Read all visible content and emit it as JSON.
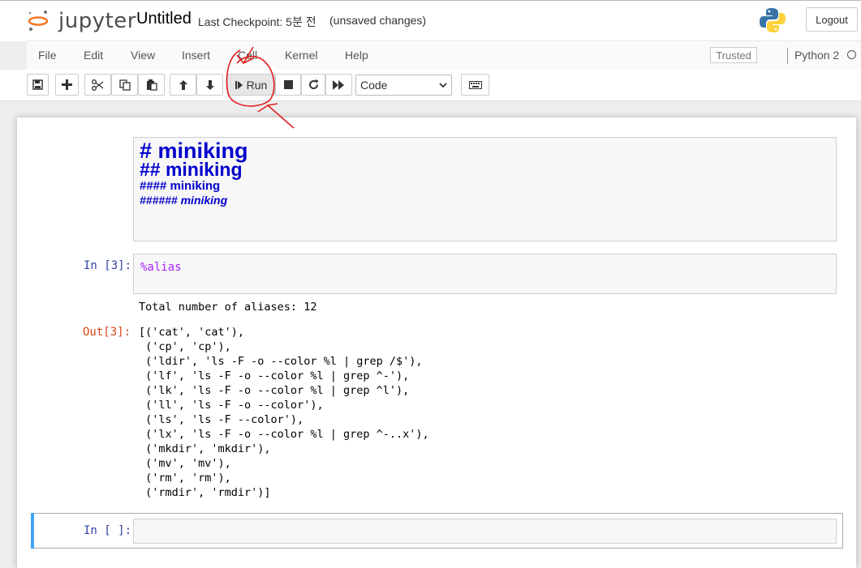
{
  "header": {
    "logo_text": "jupyter",
    "notebook_title": "Untitled",
    "checkpoint": "Last Checkpoint: 5분 전",
    "unsaved": "(unsaved changes)",
    "logout_label": "Logout"
  },
  "menubar": {
    "items": [
      "File",
      "Edit",
      "View",
      "Insert",
      "Cell",
      "Kernel",
      "Help"
    ],
    "trusted_label": "Trusted",
    "kernel_name": "Python 2"
  },
  "toolbar": {
    "run_label": "Run",
    "cell_type": "Code",
    "icons": [
      "save-icon",
      "plus-icon",
      "cut-icon",
      "copy-icon",
      "paste-icon",
      "arrow-up-icon",
      "arrow-down-icon",
      "step-forward-icon",
      "stop-icon",
      "restart-icon",
      "fast-forward-icon",
      "keyboard-icon"
    ]
  },
  "cells": {
    "markdown": {
      "lines": [
        "# miniking",
        "## miniking",
        "#### miniking",
        "###### miniking"
      ]
    },
    "code1": {
      "prompt_in": "In [3]:",
      "source_magic": "%alias",
      "stdout": "Total number of aliases: 12",
      "prompt_out": "Out[3]:",
      "output_lines": [
        "[('cat', 'cat'),",
        " ('cp', 'cp'),",
        " ('ldir', 'ls -F -o --color %l | grep /$'),",
        " ('lf', 'ls -F -o --color %l | grep ^-'),",
        " ('lk', 'ls -F -o --color %l | grep ^l'),",
        " ('ll', 'ls -F -o --color'),",
        " ('ls', 'ls -F --color'),",
        " ('lx', 'ls -F -o --color %l | grep ^-..x'),",
        " ('mkdir', 'mkdir'),",
        " ('mv', 'mv'),",
        " ('rm', 'rm'),",
        " ('rmdir', 'rmdir')]"
      ]
    },
    "empty": {
      "prompt_in": "In [ ]:"
    }
  },
  "colors": {
    "markdown_heading": "#0000cc",
    "out_prompt": "#d84315",
    "selected_bar": "#42a5f5",
    "annotation": "#e02020"
  }
}
